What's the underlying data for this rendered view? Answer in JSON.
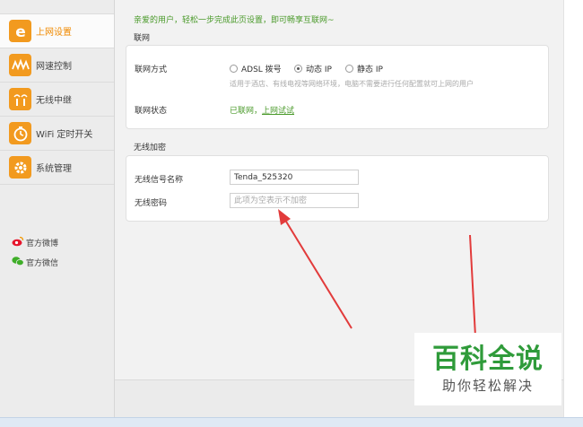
{
  "sidebar": {
    "items": [
      {
        "label": "上网设置",
        "icon": "ie-icon",
        "active": true
      },
      {
        "label": "网速控制",
        "icon": "speed-wave-icon"
      },
      {
        "label": "无线中继",
        "icon": "wireless-relay-icon"
      },
      {
        "label": "WiFi 定时开关",
        "icon": "timer-icon"
      },
      {
        "label": "系统管理",
        "icon": "gear-icon"
      }
    ],
    "social": [
      {
        "label": "官方微博",
        "icon": "weibo-icon"
      },
      {
        "label": "官方微信",
        "icon": "wechat-icon"
      }
    ]
  },
  "main": {
    "welcome": "亲爱的用户，轻松一步完成此页设置，即可畅享互联网~",
    "internet": {
      "title": "联网",
      "mode_label": "联网方式",
      "options": [
        {
          "label": "ADSL 拨号",
          "selected": false
        },
        {
          "label": "动态 IP",
          "selected": true
        },
        {
          "label": "静态 IP",
          "selected": false
        }
      ],
      "hint": "适用于酒店、有线电视等网络环境，电脑不需要进行任何配置就可上网的用户",
      "status_label": "联网状态",
      "status_value": "已联网，",
      "status_link": "上网试试"
    },
    "wireless": {
      "title": "无线加密",
      "ssid_label": "无线信号名称",
      "ssid_value": "Tenda_525320",
      "password_label": "无线密码",
      "password_placeholder": "此项为空表示不加密"
    }
  },
  "watermark": {
    "title": "百科全说",
    "subtitle": "助你轻松解决"
  },
  "colors": {
    "accent_orange": "#f29a1f",
    "status_green": "#4a9a2a",
    "watermark_green": "#2f9b3a",
    "arrow_red": "#e23b3b"
  }
}
